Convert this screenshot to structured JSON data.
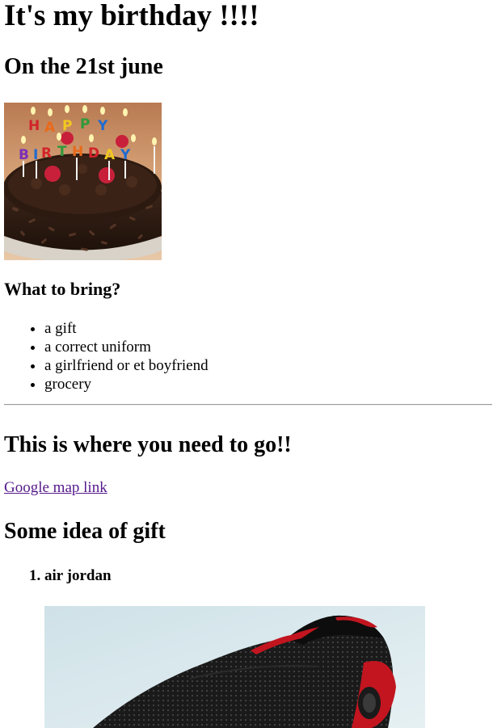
{
  "page": {
    "title": "It's my birthday !!!!",
    "date_heading": "On the 21st june",
    "cake_image": {
      "name": "birthday-cake-image",
      "cake_lettering": "HAPPY BIRTHDAY"
    },
    "bring_heading": "What to bring?",
    "bring_items": [
      "a gift",
      "a correct uniform",
      "a girlfriend or et boyfriend",
      "grocery"
    ],
    "where_heading": "This is where you need to go!!",
    "map_link_text": "Google map link",
    "gift_heading": "Some idea of gift",
    "gift_items": [
      "air jordan"
    ],
    "shoe_image": {
      "name": "air-jordan-shoe-image"
    }
  },
  "colors": {
    "link_visited": "#551a8b",
    "text": "#000000",
    "background": "#ffffff"
  }
}
